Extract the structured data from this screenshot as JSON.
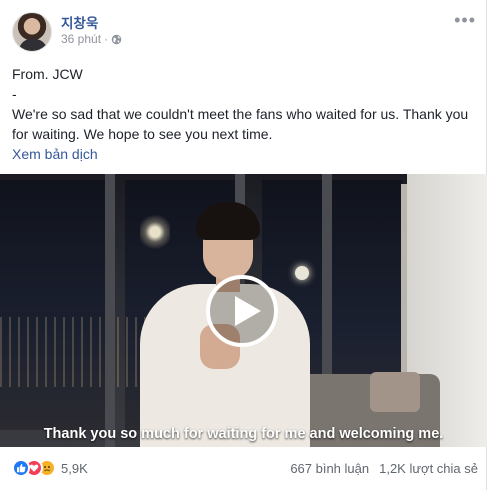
{
  "post": {
    "author": "지창욱",
    "time": "36 phút",
    "privacy_icon": "globe-icon",
    "more_icon": "more-options-icon",
    "text_lines": [
      "From. JCW",
      "-",
      "We're so sad that we couldn't meet the fans who waited for us. Thank you for waiting. We hope to see you next time."
    ],
    "translate_label": "Xem bản dịch"
  },
  "video": {
    "subtitle": "Thank you so much for waiting for me and welcoming me.",
    "play_icon": "play-icon"
  },
  "footer": {
    "reaction_icons": [
      "like-icon",
      "love-icon",
      "sad-icon"
    ],
    "reaction_count": "5,9K",
    "comments": "667 bình luận",
    "shares": "1,2K lượt chia sẻ"
  },
  "colors": {
    "link": "#365899",
    "meta": "#90949c",
    "like": "#2078f4",
    "love": "#f33e58",
    "sad": "#f7b125"
  }
}
